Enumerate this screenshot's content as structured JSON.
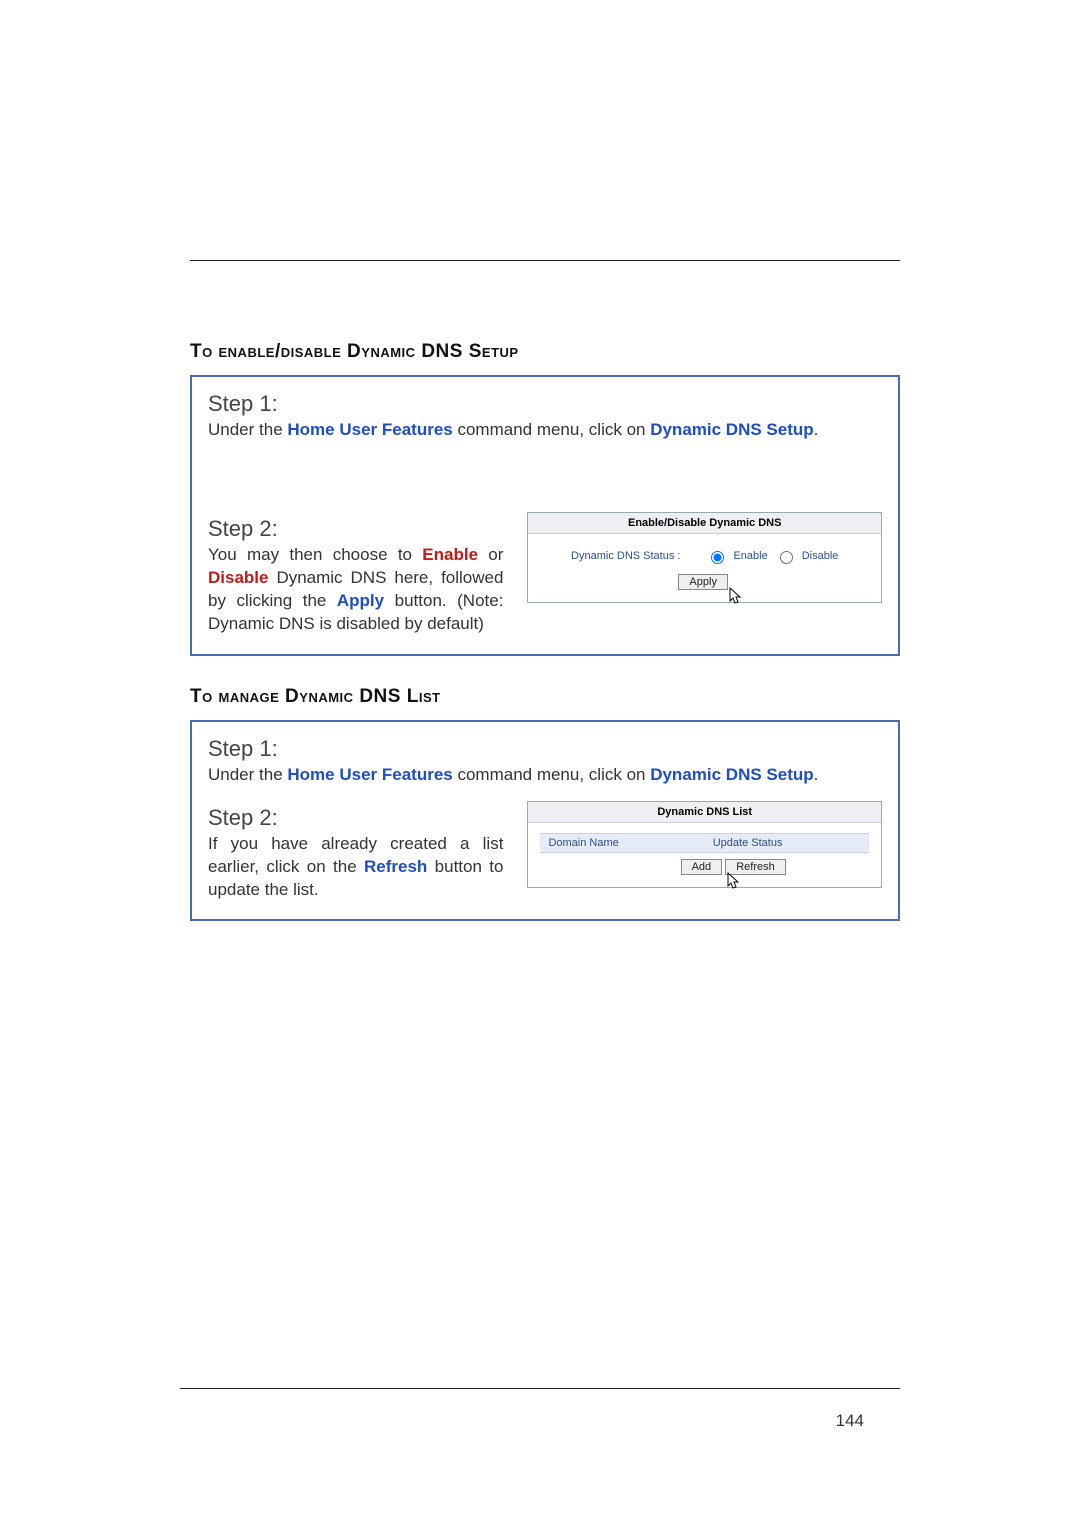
{
  "page_number": "144",
  "headings": {
    "h1": "To enable/disable Dynamic DNS Setup",
    "h2": "To manage Dynamic DNS List"
  },
  "box1": {
    "step1_title": "Step 1:",
    "step1_prefix": "Under the ",
    "step1_link1": "Home User Features",
    "step1_mid": " command menu, click on ",
    "step1_link2": "Dynamic DNS Setup",
    "step1_suffix": ".",
    "step2_title": "Step 2:",
    "step2_p1a": "You may then choose to ",
    "step2_enable": "Enable",
    "step2_p1b": " or ",
    "step2_disable": "Disable",
    "step2_p1c": " Dynamic DNS here, followed by clicking the ",
    "step2_apply": "Apply",
    "step2_p1d": " button. (Note: Dynamic DNS is disabled by default)"
  },
  "panel1": {
    "title": "Enable/Disable Dynamic DNS",
    "status_label": "Dynamic DNS Status :",
    "enable": "Enable",
    "disable": "Disable",
    "apply": "Apply"
  },
  "box2": {
    "step1_title": "Step 1:",
    "step1_prefix": "Under the ",
    "step1_link1": "Home User Features",
    "step1_mid": " command menu, click on ",
    "step1_link2": "Dynamic DNS Setup",
    "step1_suffix": ".",
    "step2_title": "Step 2:",
    "step2_a": "If you have already created a list earlier, click on the ",
    "step2_refresh": "Refresh",
    "step2_b": " button to update the list."
  },
  "panel2": {
    "title": "Dynamic DNS List",
    "col1": "Domain Name",
    "col2": "Update Status",
    "add": "Add",
    "refresh": "Refresh"
  }
}
